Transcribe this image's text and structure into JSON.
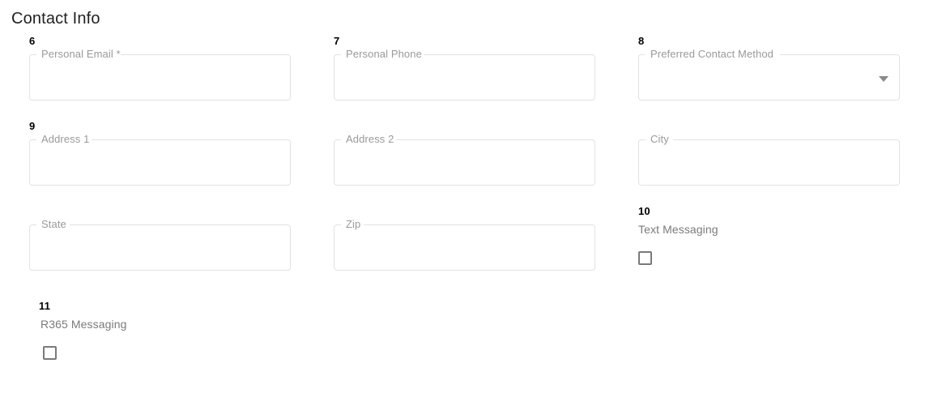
{
  "section": {
    "title": "Contact Info"
  },
  "theme": {
    "field_border": "#e2e2e2",
    "label_color": "#9a9a9a",
    "badge_color": "#000000",
    "checkbox_border": "#7a7a7a",
    "heading_color": "#1f2023",
    "background": "#ffffff"
  },
  "fields": {
    "personal_email": {
      "badge": "6",
      "label": "Personal Email *",
      "value": "",
      "placeholder": "",
      "type": "text"
    },
    "personal_phone": {
      "badge": "7",
      "label": "Personal Phone",
      "value": "",
      "placeholder": "",
      "type": "text"
    },
    "preferred_contact_method": {
      "badge": "8",
      "label": "Preferred Contact Method",
      "value": "",
      "placeholder": "",
      "type": "select",
      "icon": "chevron-down-icon"
    },
    "address_1": {
      "badge": "9",
      "label": "Address 1",
      "value": "",
      "placeholder": "",
      "type": "text"
    },
    "address_2": {
      "badge": "",
      "label": "Address 2",
      "value": "",
      "placeholder": "",
      "type": "text"
    },
    "city": {
      "badge": "",
      "label": "City",
      "value": "",
      "placeholder": "",
      "type": "text"
    },
    "state": {
      "badge": "",
      "label": "State",
      "value": "",
      "placeholder": "",
      "type": "text"
    },
    "zip": {
      "badge": "",
      "label": "Zip",
      "value": "",
      "placeholder": "",
      "type": "text"
    }
  },
  "checkboxes": {
    "text_messaging": {
      "badge": "10",
      "label": "Text Messaging",
      "checked": false
    },
    "r365_messaging": {
      "badge": "11",
      "label": "R365 Messaging",
      "checked": false
    }
  }
}
